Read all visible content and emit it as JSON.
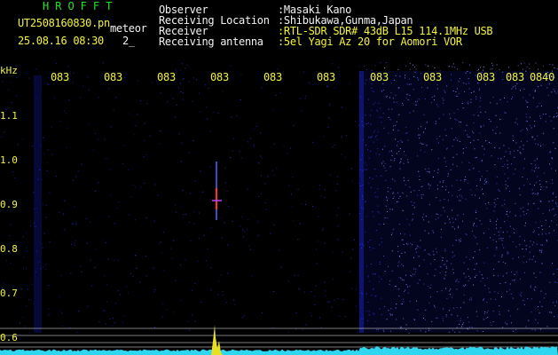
{
  "header": {
    "brand": "HROFFT",
    "filename": "UT2508160830.pn",
    "meteor_label": "meteor",
    "datetime": "25.08.16 08:30",
    "count": "2_"
  },
  "meta": {
    "labels": [
      "Observer",
      "Receiving Location",
      "Receiver",
      "Receiving antenna"
    ],
    "values": [
      ":Masaki Kano",
      ":Shibukawa,Gunma,Japan",
      ":RTL-SDR SDR# 43dB L15 114.1MHz USB",
      ":5el Yagi Az 20 for Aomori VOR"
    ]
  },
  "axis": {
    "y_unit": "kHz",
    "y_ticks": [
      "1.1",
      "1.0",
      "0.9",
      "0.8",
      "0.7",
      "0.6"
    ],
    "x_ticks": [
      "083",
      "083",
      "083",
      "083",
      "083",
      "083",
      "083",
      "083",
      "083",
      "083",
      "0840"
    ]
  },
  "colors": {
    "background": "#000000",
    "noise_blue": "#1a2aff",
    "text_yellow": "#f3f33a",
    "brand_green": "#1fe81f",
    "floor_cyan": "#2fd6f0",
    "meteor_red": "#ff3030",
    "peak_yellow": "#e8e020"
  }
}
